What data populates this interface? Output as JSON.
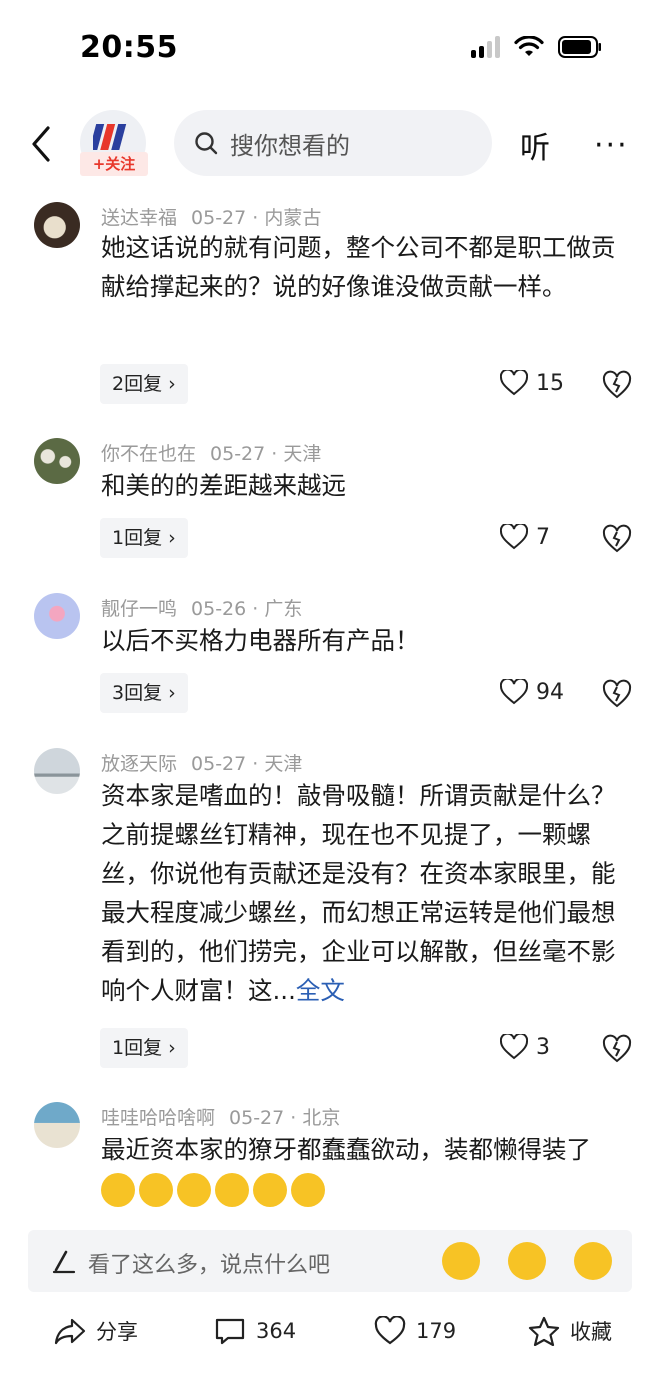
{
  "status_bar": {
    "time": "20:55"
  },
  "header": {
    "follow_label": "+关注",
    "search_placeholder": "搜你想看的",
    "listen_label": "听",
    "more_label": "···"
  },
  "comments": [
    {
      "user": "送达幸福",
      "date": "05-27",
      "location": "内蒙古",
      "text": "她这话说的就有问题，整个公司不都是职工做贡献给撑起来的？说的好像谁没做贡献一样。",
      "replies": "2回复",
      "likes": "15"
    },
    {
      "user": "你不在也在",
      "date": "05-27",
      "location": "天津",
      "text": "和美的的差距越来越远",
      "replies": "1回复",
      "likes": "7"
    },
    {
      "user": "靓仔一鸣",
      "date": "05-26",
      "location": "广东",
      "text": "以后不买格力电器所有产品！",
      "replies": "3回复",
      "likes": "94"
    },
    {
      "user": "放逐天际",
      "date": "05-27",
      "location": "天津",
      "text": "资本家是嗜血的！敲骨吸髓！所谓贡献是什么？之前提螺丝钉精神，现在也不见提了，一颗螺丝，你说他有贡献还是没有？在资本家眼里，能最大程度减少螺丝，而幻想正常运转是他们最想看到的，他们捞完，企业可以解散，但丝毫不影响个人财富！这...",
      "full_text_link": "全文",
      "replies": "1回复",
      "likes": "3"
    },
    {
      "user": "哇哇哈哈啥啊",
      "date": "05-27",
      "location": "北京",
      "text": "最近资本家的獠牙都蠢蠢欲动，装都懒得装了"
    }
  ],
  "input_bar": {
    "placeholder": "看了这么多，说点什么吧"
  },
  "action_bar": {
    "share_label": "分享",
    "comments_count": "364",
    "likes_count": "179",
    "favorite_label": "收藏"
  },
  "colors": {
    "accent_red": "#e8372b",
    "link_blue": "#2b5fb4",
    "emoji_yellow": "#f7c325"
  },
  "icons": [
    "signal-icon",
    "wifi-icon",
    "battery-icon",
    "back-arrow-icon",
    "search-icon",
    "heart-icon",
    "broken-heart-icon",
    "pen-icon",
    "share-icon",
    "comment-icon",
    "star-icon"
  ]
}
